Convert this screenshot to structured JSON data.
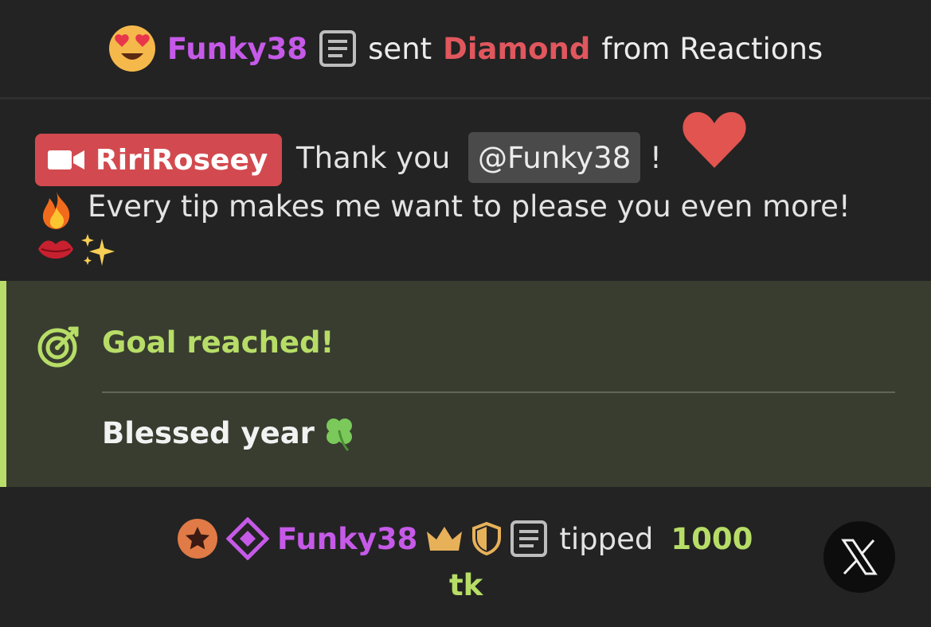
{
  "top_event": {
    "username": "Funky38",
    "action": "sent",
    "gift_name": "Diamond",
    "suffix": "from Reactions"
  },
  "message": {
    "author": "RiriRoseey",
    "greeting": "Thank you",
    "mention": "@Funky38",
    "bang": "!",
    "line2": "Every tip makes me want to please you even more!"
  },
  "goal": {
    "title": "Goal reached!",
    "text": "Blessed year"
  },
  "tip": {
    "username": "Funky38",
    "action": "tipped",
    "amount": "1000",
    "unit": "tk"
  },
  "colors": {
    "username": "#c65ae8",
    "gift": "#e0575d",
    "goal_accent": "#b7dd67",
    "badge": "#d24a4f"
  },
  "icons": {
    "face": "heart-eyes-emoji-icon",
    "doc": "document-icon",
    "camera": "video-camera-icon",
    "heart": "heart-icon",
    "fire": "fire-emoji-icon",
    "lips": "kiss-emoji-icon",
    "sparkles": "sparkles-emoji-icon",
    "target": "target-icon",
    "clover": "four-leaf-clover-icon",
    "star": "star-badge-icon",
    "diamond": "diamond-badge-icon",
    "crown": "crown-icon",
    "shield": "shield-icon",
    "close": "x-close-icon"
  }
}
